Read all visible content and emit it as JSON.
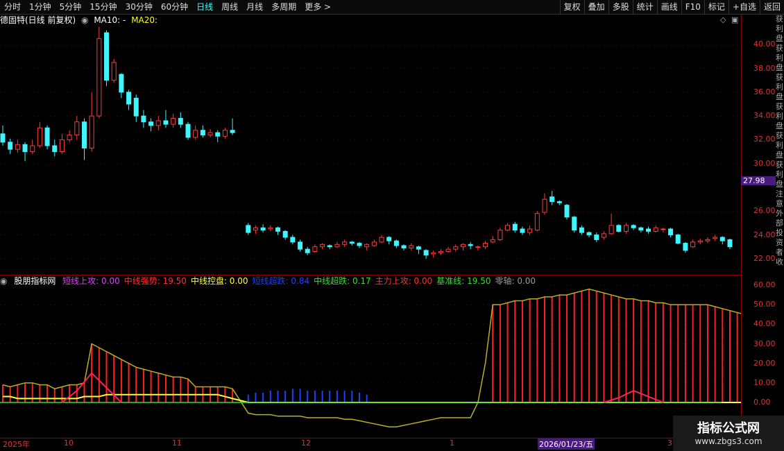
{
  "toolbar": {
    "periods": [
      "分时",
      "1分钟",
      "5分钟",
      "15分钟",
      "30分钟",
      "60分钟",
      "日线",
      "周线",
      "月线",
      "多周期",
      "更多 >"
    ],
    "active": "日线",
    "actions": [
      "复权",
      "叠加",
      "多股",
      "统计",
      "画线",
      "F10",
      "标记",
      "+自选",
      "返回"
    ]
  },
  "header": {
    "stock": "德固特(日线 前复权)",
    "ma10": "MA10: -",
    "ma20": "MA20:"
  },
  "price_axis": [
    "40.00",
    "38.00",
    "36.00",
    "34.00",
    "32.00",
    "30.00",
    "26.00",
    "24.00",
    "22.00"
  ],
  "price_highlight": "27.98",
  "indicator": {
    "name": "股朋指标网",
    "items": [
      {
        "label": "短线上攻: 0.00",
        "color": "#e040fb"
      },
      {
        "label": "中线强势: 19.50",
        "color": "#ff3030"
      },
      {
        "label": "中线控盘: 0.00",
        "color": "#ffff40"
      },
      {
        "label": "短线超跌: 0.84",
        "color": "#2040ff"
      },
      {
        "label": "中线超跌: 0.17",
        "color": "#30e030"
      },
      {
        "label": "主力上攻: 0.00",
        "color": "#ff3030"
      },
      {
        "label": "基准线: 19.50",
        "color": "#30e030"
      },
      {
        "label": "零轴: 0.00",
        "color": "#999999"
      }
    ]
  },
  "ind_axis": [
    "60.00",
    "50.00",
    "40.00",
    "30.00",
    "20.00",
    "10.00",
    "0.00"
  ],
  "dates": [
    {
      "label": "2025年"
    },
    {
      "label": "10"
    },
    {
      "label": "11"
    },
    {
      "label": "12"
    },
    {
      "label": "1"
    },
    {
      "label": "2026/01/23/五"
    },
    {
      "label": "3"
    }
  ],
  "watermark": {
    "title": "指标公式网",
    "url": "www.zbgs3.com"
  },
  "side_text": "获利盘获利盘获利盘获利盘获利盘获利盘注意外部投资者收",
  "chart_data": {
    "type": "candlestick",
    "ylim": [
      21,
      42
    ],
    "candles": [
      [
        32.5,
        31.8,
        33.2,
        31.5
      ],
      [
        31.8,
        31.2,
        32.1,
        30.8
      ],
      [
        31.2,
        31.6,
        32.0,
        30.9
      ],
      [
        31.6,
        31.0,
        31.8,
        30.2
      ],
      [
        31.0,
        31.5,
        32.0,
        30.8
      ],
      [
        31.5,
        33.0,
        33.5,
        31.3
      ],
      [
        33.0,
        31.5,
        33.2,
        31.2
      ],
      [
        31.5,
        31.0,
        32.0,
        30.6
      ],
      [
        31.0,
        32.0,
        32.5,
        30.8
      ],
      [
        32.0,
        32.4,
        32.8,
        31.8
      ],
      [
        32.4,
        33.5,
        34.0,
        32.0
      ],
      [
        33.5,
        31.3,
        33.8,
        30.3
      ],
      [
        31.3,
        34.0,
        36.0,
        31.0
      ],
      [
        34.0,
        40.5,
        41.5,
        33.8
      ],
      [
        41.0,
        37.0,
        41.2,
        36.5
      ],
      [
        37.0,
        38.5,
        38.8,
        36.8
      ],
      [
        37.5,
        36.0,
        37.6,
        35.5
      ],
      [
        36.0,
        35.0,
        36.2,
        34.5
      ],
      [
        35.5,
        34.0,
        35.8,
        33.5
      ],
      [
        34.0,
        33.5,
        34.5,
        33.0
      ],
      [
        33.5,
        33.2,
        33.8,
        32.7
      ],
      [
        33.2,
        33.6,
        34.0,
        32.8
      ],
      [
        33.6,
        33.3,
        34.5,
        33.0
      ],
      [
        33.3,
        33.8,
        34.2,
        33.0
      ],
      [
        33.8,
        33.3,
        34.3,
        33.0
      ],
      [
        33.3,
        32.2,
        33.5,
        32.0
      ],
      [
        32.2,
        32.8,
        33.2,
        32.0
      ],
      [
        32.8,
        32.4,
        33.2,
        32.2
      ],
      [
        32.4,
        32.6,
        32.9,
        32.2
      ],
      [
        32.6,
        32.3,
        32.8,
        31.8
      ],
      [
        32.3,
        32.8,
        33.0,
        32.1
      ],
      [
        32.8,
        32.6,
        33.8,
        32.4
      ],
      [
        24.8,
        24.2,
        25.0,
        24.0
      ],
      [
        24.4,
        24.6,
        24.8,
        24.1
      ],
      [
        24.6,
        24.4,
        24.9,
        24.2
      ],
      [
        24.5,
        24.6,
        24.8,
        24.3
      ],
      [
        24.6,
        24.3,
        24.7,
        24.0
      ],
      [
        24.3,
        23.8,
        24.4,
        23.6
      ],
      [
        23.8,
        23.4,
        24.0,
        23.2
      ],
      [
        23.4,
        22.8,
        23.6,
        22.6
      ],
      [
        22.8,
        22.5,
        23.0,
        22.3
      ],
      [
        22.6,
        23.0,
        23.2,
        22.5
      ],
      [
        23.0,
        23.2,
        23.3,
        22.8
      ],
      [
        23.1,
        23.0,
        23.2,
        22.8
      ],
      [
        23.0,
        23.2,
        23.4,
        22.9
      ],
      [
        23.2,
        23.4,
        23.6,
        23.0
      ],
      [
        23.4,
        23.3,
        23.5,
        23.1
      ],
      [
        23.3,
        23.1,
        23.4,
        22.9
      ],
      [
        23.0,
        23.2,
        23.3,
        22.7
      ],
      [
        23.1,
        23.4,
        23.6,
        23.0
      ],
      [
        23.4,
        23.8,
        24.0,
        23.3
      ],
      [
        23.8,
        23.5,
        23.9,
        23.2
      ],
      [
        23.5,
        23.1,
        23.6,
        22.9
      ],
      [
        23.1,
        22.9,
        23.2,
        22.7
      ],
      [
        22.9,
        23.1,
        23.3,
        22.7
      ],
      [
        23.0,
        22.8,
        23.1,
        22.4
      ],
      [
        22.7,
        22.3,
        22.8,
        22.0
      ],
      [
        22.4,
        22.5,
        22.7,
        22.1
      ],
      [
        22.5,
        22.6,
        22.8,
        22.3
      ],
      [
        22.6,
        22.8,
        23.0,
        22.5
      ],
      [
        22.8,
        23.0,
        23.2,
        22.6
      ],
      [
        23.0,
        23.2,
        23.3,
        22.7
      ],
      [
        23.2,
        23.1,
        23.4,
        22.8
      ],
      [
        23.0,
        23.0,
        23.1,
        22.7
      ],
      [
        23.0,
        23.3,
        23.5,
        22.8
      ],
      [
        23.4,
        23.6,
        23.9,
        23.3
      ],
      [
        23.6,
        24.4,
        24.6,
        23.5
      ],
      [
        24.4,
        24.8,
        25.0,
        24.3
      ],
      [
        24.9,
        24.4,
        25.1,
        24.2
      ],
      [
        24.5,
        24.2,
        24.7,
        24.0
      ],
      [
        24.2,
        24.5,
        24.8,
        24.0
      ],
      [
        24.4,
        25.8,
        26.0,
        24.3
      ],
      [
        25.9,
        27.0,
        27.5,
        25.7
      ],
      [
        27.2,
        26.8,
        27.7,
        26.5
      ],
      [
        26.8,
        26.7,
        26.9,
        26.5
      ],
      [
        26.5,
        25.5,
        26.6,
        25.3
      ],
      [
        25.5,
        24.4,
        25.6,
        24.2
      ],
      [
        24.6,
        24.2,
        24.8,
        24.0
      ],
      [
        24.2,
        24.0,
        24.3,
        23.8
      ],
      [
        24.0,
        23.6,
        24.2,
        23.4
      ],
      [
        23.8,
        24.1,
        24.3,
        23.6
      ],
      [
        24.1,
        24.8,
        25.8,
        24.0
      ],
      [
        24.8,
        24.3,
        24.9,
        24.2
      ],
      [
        24.3,
        24.8,
        25.0,
        24.1
      ],
      [
        24.8,
        24.6,
        24.9,
        24.4
      ],
      [
        24.6,
        24.4,
        24.7,
        24.2
      ],
      [
        24.5,
        24.3,
        24.7,
        24.1
      ],
      [
        24.3,
        24.6,
        24.8,
        24.2
      ],
      [
        24.5,
        24.5,
        24.6,
        24.2
      ],
      [
        24.5,
        24.0,
        24.6,
        23.8
      ],
      [
        24.0,
        23.3,
        24.1,
        23.2
      ],
      [
        23.3,
        22.7,
        23.4,
        22.5
      ],
      [
        23.0,
        23.4,
        23.6,
        22.9
      ],
      [
        23.4,
        23.5,
        23.7,
        23.2
      ],
      [
        23.5,
        23.6,
        23.8,
        23.3
      ],
      [
        23.7,
        23.8,
        24.0,
        23.5
      ],
      [
        23.8,
        23.5,
        23.9,
        23.2
      ],
      [
        23.6,
        23.0,
        23.7,
        22.8
      ]
    ],
    "ind_red": [
      9,
      8,
      9,
      10,
      10,
      9,
      9,
      7,
      8,
      9,
      9,
      10,
      30,
      28,
      26,
      24,
      22,
      20,
      18,
      17,
      16,
      15,
      14,
      13,
      13,
      12,
      8,
      8,
      8,
      8,
      8,
      7,
      0,
      0,
      0,
      0,
      0,
      0,
      0,
      0,
      0,
      0,
      0,
      0,
      0,
      0,
      0,
      0,
      0,
      0,
      0,
      0,
      0,
      0,
      0,
      0,
      0,
      0,
      0,
      0,
      0,
      0,
      0,
      0,
      0,
      50,
      50,
      51,
      52,
      52,
      53,
      53,
      54,
      54,
      55,
      55,
      56,
      57,
      58,
      57,
      56,
      55,
      54,
      53,
      53,
      52,
      52,
      51,
      51,
      50,
      50,
      50,
      50,
      50,
      50,
      49,
      48,
      47,
      46,
      45,
      44,
      43,
      42,
      41,
      20
    ],
    "ind_blue": [
      0,
      0,
      0,
      0,
      0,
      0,
      0,
      0,
      0,
      0,
      0,
      0,
      0,
      0,
      0,
      0,
      0,
      0,
      0,
      0,
      0,
      0,
      0,
      0,
      0,
      0,
      0,
      0,
      0,
      0,
      0,
      0,
      4,
      5,
      5,
      6,
      6,
      6,
      7,
      7,
      6,
      6,
      6,
      6,
      6,
      6,
      6,
      5,
      4,
      0,
      0,
      0,
      0,
      0,
      0,
      0,
      0,
      0,
      0,
      0,
      0,
      0,
      0,
      0,
      0,
      0,
      0,
      0,
      0,
      0,
      0,
      0,
      0,
      0,
      0,
      0,
      0,
      0,
      0,
      0,
      0,
      0,
      0,
      0,
      0,
      0,
      0,
      0,
      0,
      0,
      0,
      0,
      0,
      0,
      0,
      0,
      0,
      0,
      0,
      0,
      0,
      0,
      0,
      0,
      0
    ],
    "ind_line": [
      9,
      8,
      9,
      10,
      10,
      9,
      9,
      7,
      8,
      9,
      9,
      10,
      30,
      28,
      26,
      24,
      22,
      20,
      18,
      17,
      16,
      15,
      14,
      13,
      13,
      12,
      8,
      8,
      8,
      8,
      8,
      7,
      -7,
      -8,
      -8,
      -8,
      -9,
      -9,
      -9,
      -9,
      -10,
      -10,
      -10,
      -10,
      -10,
      -11,
      -11,
      -12,
      -13,
      -14,
      -15,
      -16,
      -16,
      -15,
      -14,
      -13,
      -12,
      -11,
      -10,
      -10,
      -10,
      -10,
      -10,
      0,
      20,
      50,
      50,
      51,
      52,
      52,
      53,
      53,
      54,
      54,
      55,
      55,
      56,
      57,
      58,
      57,
      56,
      55,
      54,
      53,
      53,
      52,
      52,
      51,
      51,
      50,
      50,
      50,
      50,
      50,
      50,
      49,
      48,
      47,
      46,
      45,
      44,
      43,
      42,
      41,
      20
    ],
    "ind_yellow": [
      3,
      3,
      2,
      2,
      2,
      2,
      2,
      2,
      2,
      2,
      2,
      3,
      3,
      3,
      4,
      4,
      4,
      4,
      4,
      4,
      4,
      4,
      4,
      4,
      4,
      4,
      4,
      4,
      4,
      4,
      3,
      2,
      0,
      0,
      0,
      0,
      0,
      0,
      0,
      0,
      0,
      0,
      0,
      0,
      0,
      0,
      0,
      0,
      0,
      0,
      0,
      0,
      0,
      0,
      0,
      0,
      0,
      0,
      0,
      0,
      0,
      0,
      0,
      0,
      0,
      0,
      0,
      0,
      0,
      0,
      0,
      0,
      0,
      0,
      0,
      0,
      0,
      0,
      0,
      0,
      0,
      0,
      0,
      0,
      0,
      0,
      0,
      0,
      0,
      0,
      0,
      0,
      0,
      0,
      0,
      0,
      0,
      0,
      0,
      0,
      0,
      0,
      0,
      0,
      0
    ],
    "ind_magenta_peaks": [
      [
        12,
        15
      ],
      [
        84,
        6
      ]
    ]
  }
}
